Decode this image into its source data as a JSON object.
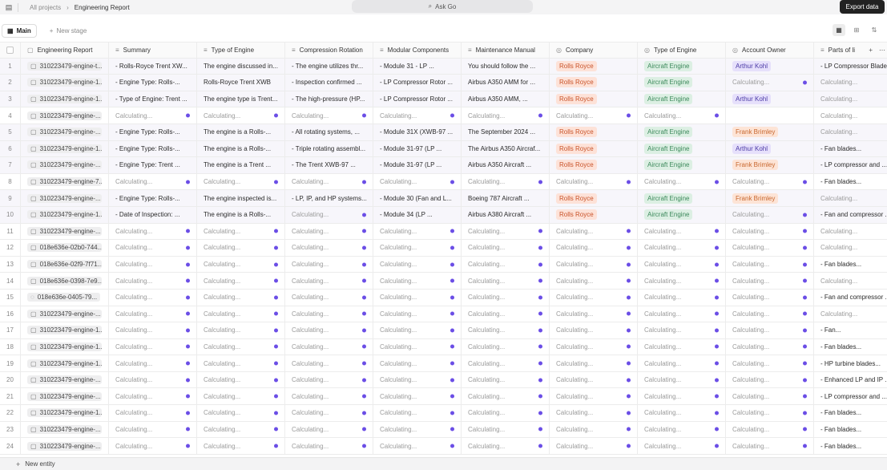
{
  "breadcrumb": {
    "parent": "All projects",
    "current": "Engineering Report"
  },
  "ask": {
    "label": "Ask Go"
  },
  "export_label": "Export data",
  "stages": {
    "main_label": "Main",
    "new_stage_label": "New stage"
  },
  "new_entity_label": "New entity",
  "calc": "Calculating...",
  "colors": {
    "accent_dot": "#6b4ee6",
    "rolls_royce": "#c9542b",
    "aircraft_engine": "#3d8a5c",
    "arthur_kohl": "#4b3aa6",
    "frank_brimley": "#c8672e"
  },
  "columns": [
    "Engineering Report",
    "Summary",
    "Type of Engine",
    "Compression Rotation",
    "Modular Components",
    "Maintenance Manual",
    "Company",
    "Type of Engine",
    "Account Owner",
    "Parts of li"
  ],
  "rows": [
    {
      "idx": "1",
      "report": "310223479-engine-t...",
      "summary": "- Rolls-Royce Trent XW...",
      "type": "The engine discussed in...",
      "comp": "- The engine utilizes thr...",
      "mod": "- Module 31 - LP ...",
      "manual": "You should follow the ...",
      "company": "Rolls Royce",
      "type2": "Aircraft Engine",
      "owner": "Arthur Kohl",
      "parts": "- LP Compressor Blade..."
    },
    {
      "idx": "2",
      "report": "310223479-engine-1...",
      "summary": "- Engine Type: Rolls-...",
      "type": "Rolls-Royce Trent XWB",
      "comp": "- Inspection confirmed ...",
      "mod": "- LP Compressor Rotor ...",
      "manual": "Airbus A350 AMM for ...",
      "company": "Rolls Royce",
      "type2": "Aircraft Engine",
      "owner": "",
      "parts": ""
    },
    {
      "idx": "3",
      "report": "310223479-engine-1...",
      "summary": "- Type of Engine: Trent ...",
      "type": "The engine type is Trent...",
      "comp": "- The high-pressure (HP...",
      "mod": "- LP Compressor Rotor ...",
      "manual": "Airbus A350 AMM, ...",
      "company": "Rolls Royce",
      "type2": "Aircraft Engine",
      "owner": "Arthur Kohl",
      "parts": ""
    },
    {
      "idx": "4",
      "report": "310223479-engine-...",
      "summary": "",
      "type": "",
      "comp": "",
      "mod": "",
      "manual": "",
      "company": "",
      "type2": "",
      "owner": "",
      "parts": ""
    },
    {
      "idx": "5",
      "report": "310223479-engine-...",
      "summary": "- Engine Type: Rolls-...",
      "type": "The engine is a Rolls-...",
      "comp": "- All rotating systems, ...",
      "mod": "- Module 31X (XWB-97 ...",
      "manual": "The September 2024 ...",
      "company": "Rolls Royce",
      "type2": "Aircraft Engine",
      "owner": "Frank Brimley",
      "parts": ""
    },
    {
      "idx": "6",
      "report": "310223479-engine-1...",
      "summary": "- Engine Type: Rolls-...",
      "type": "The engine is a Rolls-...",
      "comp": "- Triple rotating assembl...",
      "mod": "- Module 31-97 (LP ...",
      "manual": "The Airbus A350 Aircraf...",
      "company": "Rolls Royce",
      "type2": "Aircraft Engine",
      "owner": "Arthur Kohl",
      "parts": "- Fan blades..."
    },
    {
      "idx": "7",
      "report": "310223479-engine-...",
      "summary": "- Engine Type: Trent ...",
      "type": "The engine is a Trent ...",
      "comp": "- The Trent XWB-97 ...",
      "mod": "- Module 31-97 (LP ...",
      "manual": "Airbus A350 Aircraft ...",
      "company": "Rolls Royce",
      "type2": "Aircraft Engine",
      "owner": "Frank Brimley",
      "parts": "- LP compressor and ..."
    },
    {
      "idx": "8",
      "report": "310223479-engine-7...",
      "summary": "",
      "type": "",
      "comp": "",
      "mod": "",
      "manual": "",
      "company": "",
      "type2": "",
      "owner": "",
      "parts": "- Fan blades..."
    },
    {
      "idx": "9",
      "report": "310223479-engine-...",
      "summary": "- Engine Type: Rolls-...",
      "type": "The engine inspected is...",
      "comp": "- LP, IP, and HP systems...",
      "mod": "- Module 30 (Fan and L...",
      "manual": "Boeing 787 Aircraft ...",
      "company": "Rolls Royce",
      "type2": "Aircraft Engine",
      "owner": "Frank Brimley",
      "parts": ""
    },
    {
      "idx": "10",
      "report": "310223479-engine-1...",
      "summary": "- Date of Inspection: ...",
      "type": "The engine is a Rolls-...",
      "comp": "",
      "mod": "- Module 34 (LP ...",
      "manual": "Airbus A380 Aircraft ...",
      "company": "Rolls Royce",
      "type2": "Aircraft Engine",
      "owner": "",
      "parts": "- Fan and compressor ..."
    },
    {
      "idx": "11",
      "report": "310223479-engine-...",
      "summary": "",
      "type": "",
      "comp": "",
      "mod": "",
      "manual": "",
      "company": "",
      "type2": "",
      "owner": "",
      "parts": ""
    },
    {
      "idx": "12",
      "report": "018e636e-02b0-744...",
      "summary": "",
      "type": "",
      "comp": "",
      "mod": "",
      "manual": "",
      "company": "",
      "type2": "",
      "owner": "",
      "parts": ""
    },
    {
      "idx": "13",
      "report": "018e636e-02f9-7f71...",
      "summary": "",
      "type": "",
      "comp": "",
      "mod": "",
      "manual": "",
      "company": "",
      "type2": "",
      "owner": "",
      "parts": "- Fan blades..."
    },
    {
      "idx": "14",
      "report": "018e636e-0398-7e9...",
      "summary": "",
      "type": "",
      "comp": "",
      "mod": "",
      "manual": "",
      "company": "",
      "type2": "",
      "owner": "",
      "parts": ""
    },
    {
      "idx": "15",
      "report": "018e636e-0405-79...",
      "summary": "",
      "type": "",
      "comp": "",
      "mod": "",
      "manual": "",
      "company": "",
      "type2": "",
      "owner": "",
      "parts": "- Fan and compressor ..."
    },
    {
      "idx": "16",
      "report": "310223479-engine-...",
      "summary": "",
      "type": "",
      "comp": "",
      "mod": "",
      "manual": "",
      "company": "",
      "type2": "",
      "owner": "",
      "parts": ""
    },
    {
      "idx": "17",
      "report": "310223479-engine-1...",
      "summary": "",
      "type": "",
      "comp": "",
      "mod": "",
      "manual": "",
      "company": "",
      "type2": "",
      "owner": "",
      "parts": "- Fan..."
    },
    {
      "idx": "18",
      "report": "310223479-engine-1...",
      "summary": "",
      "type": "",
      "comp": "",
      "mod": "",
      "manual": "",
      "company": "",
      "type2": "",
      "owner": "",
      "parts": "- Fan blades..."
    },
    {
      "idx": "19",
      "report": "310223479-engine-1...",
      "summary": "",
      "type": "",
      "comp": "",
      "mod": "",
      "manual": "",
      "company": "",
      "type2": "",
      "owner": "",
      "parts": "- HP turbine blades..."
    },
    {
      "idx": "20",
      "report": "310223479-engine-...",
      "summary": "",
      "type": "",
      "comp": "",
      "mod": "",
      "manual": "",
      "company": "",
      "type2": "",
      "owner": "",
      "parts": "- Enhanced LP and IP ..."
    },
    {
      "idx": "21",
      "report": "310223479-engine-...",
      "summary": "",
      "type": "",
      "comp": "",
      "mod": "",
      "manual": "",
      "company": "",
      "type2": "",
      "owner": "",
      "parts": "- LP compressor and ..."
    },
    {
      "idx": "22",
      "report": "310223479-engine-1...",
      "summary": "",
      "type": "",
      "comp": "",
      "mod": "",
      "manual": "",
      "company": "",
      "type2": "",
      "owner": "",
      "parts": "- Fan blades..."
    },
    {
      "idx": "23",
      "report": "310223479-engine-...",
      "summary": "",
      "type": "",
      "comp": "",
      "mod": "",
      "manual": "",
      "company": "",
      "type2": "",
      "owner": "",
      "parts": "- Fan blades..."
    },
    {
      "idx": "24",
      "report": "310223479-engine-...",
      "summary": "",
      "type": "",
      "comp": "",
      "mod": "",
      "manual": "",
      "company": "",
      "type2": "",
      "owner": "",
      "parts": "- Fan blades..."
    }
  ]
}
